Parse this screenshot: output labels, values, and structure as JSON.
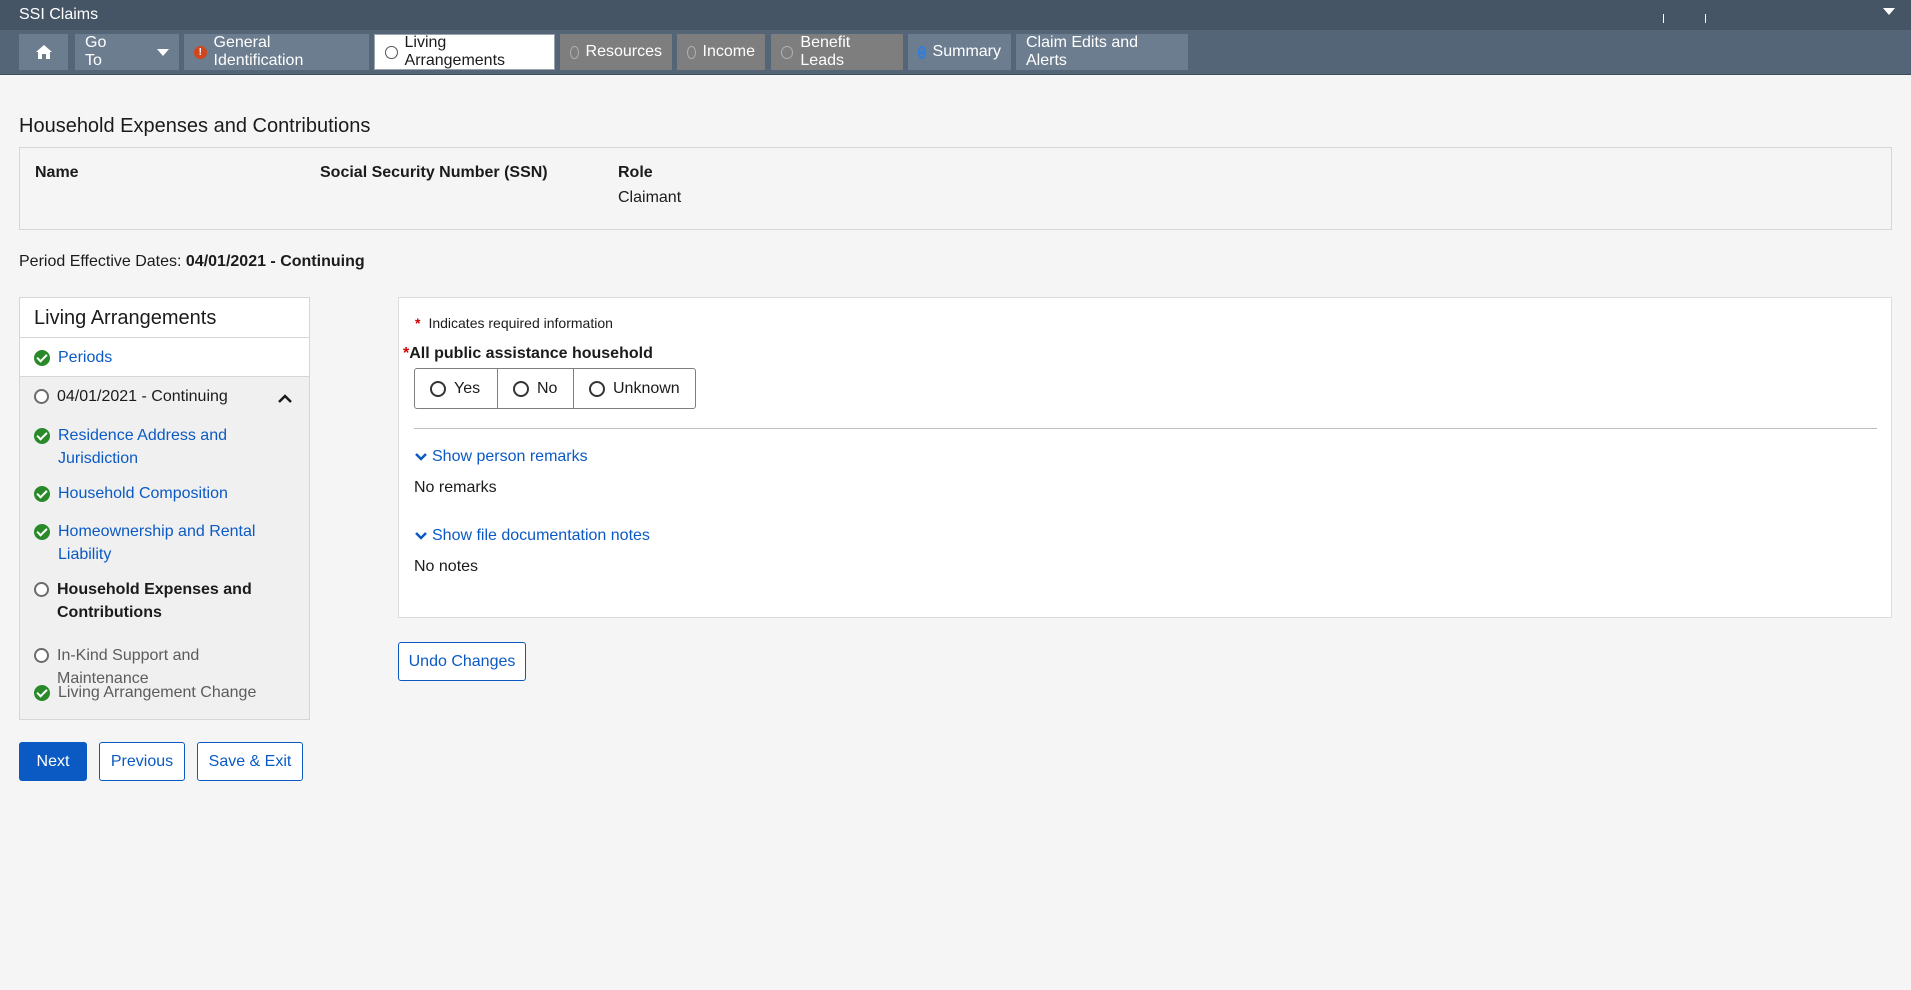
{
  "app": {
    "title": "SSI Claims"
  },
  "nav": {
    "goto_label": "Go To",
    "tabs": [
      {
        "label": "General Identification",
        "status": "alert"
      },
      {
        "label": "Living Arrangements",
        "status": "active"
      },
      {
        "label": "Resources",
        "status": "incomplete"
      },
      {
        "label": "Income",
        "status": "incomplete"
      },
      {
        "label": "Benefit Leads",
        "status": "incomplete"
      },
      {
        "label": "Summary",
        "status": "selected"
      },
      {
        "label": "Claim Edits and Alerts",
        "status": "none"
      }
    ]
  },
  "page": {
    "title": "Household Expenses and Contributions",
    "person": {
      "name_header": "Name",
      "ssn_header": "Social Security Number (SSN)",
      "role_header": "Role",
      "name_value": "",
      "ssn_value": "",
      "role_value": "Claimant"
    },
    "period_label": "Period Effective Dates:",
    "period_value": "04/01/2021 - Continuing"
  },
  "leftnav": {
    "title": "Living Arrangements",
    "periods": "Periods",
    "period": "04/01/2021 - Continuing",
    "items": [
      {
        "label": "Residence Address and Jurisdiction",
        "status": "complete"
      },
      {
        "label": "Household Composition",
        "status": "complete"
      },
      {
        "label": "Homeownership and Rental Liability",
        "status": "complete"
      },
      {
        "label": "Household Expenses and Contributions",
        "status": "current"
      },
      {
        "label": "In-Kind Support and Maintenance",
        "status": "incomplete"
      },
      {
        "label": "Living Arrangement Change",
        "status": "complete"
      }
    ]
  },
  "form": {
    "required_note": "Indicates required information",
    "question": "All public assistance household",
    "options": [
      "Yes",
      "No",
      "Unknown"
    ],
    "show_remarks": "Show person remarks",
    "remarks_text": "No remarks",
    "show_notes": "Show file documentation notes",
    "notes_text": "No notes",
    "undo_label": "Undo Changes"
  },
  "footer": {
    "next_label": "Next",
    "previous_label": "Previous",
    "save_exit_label": "Save & Exit"
  },
  "colors": {
    "topbar": "#455566",
    "navbar": "#536577",
    "link": "#0b5ac4",
    "complete": "#2a8a2a",
    "alert": "#d0461e"
  }
}
